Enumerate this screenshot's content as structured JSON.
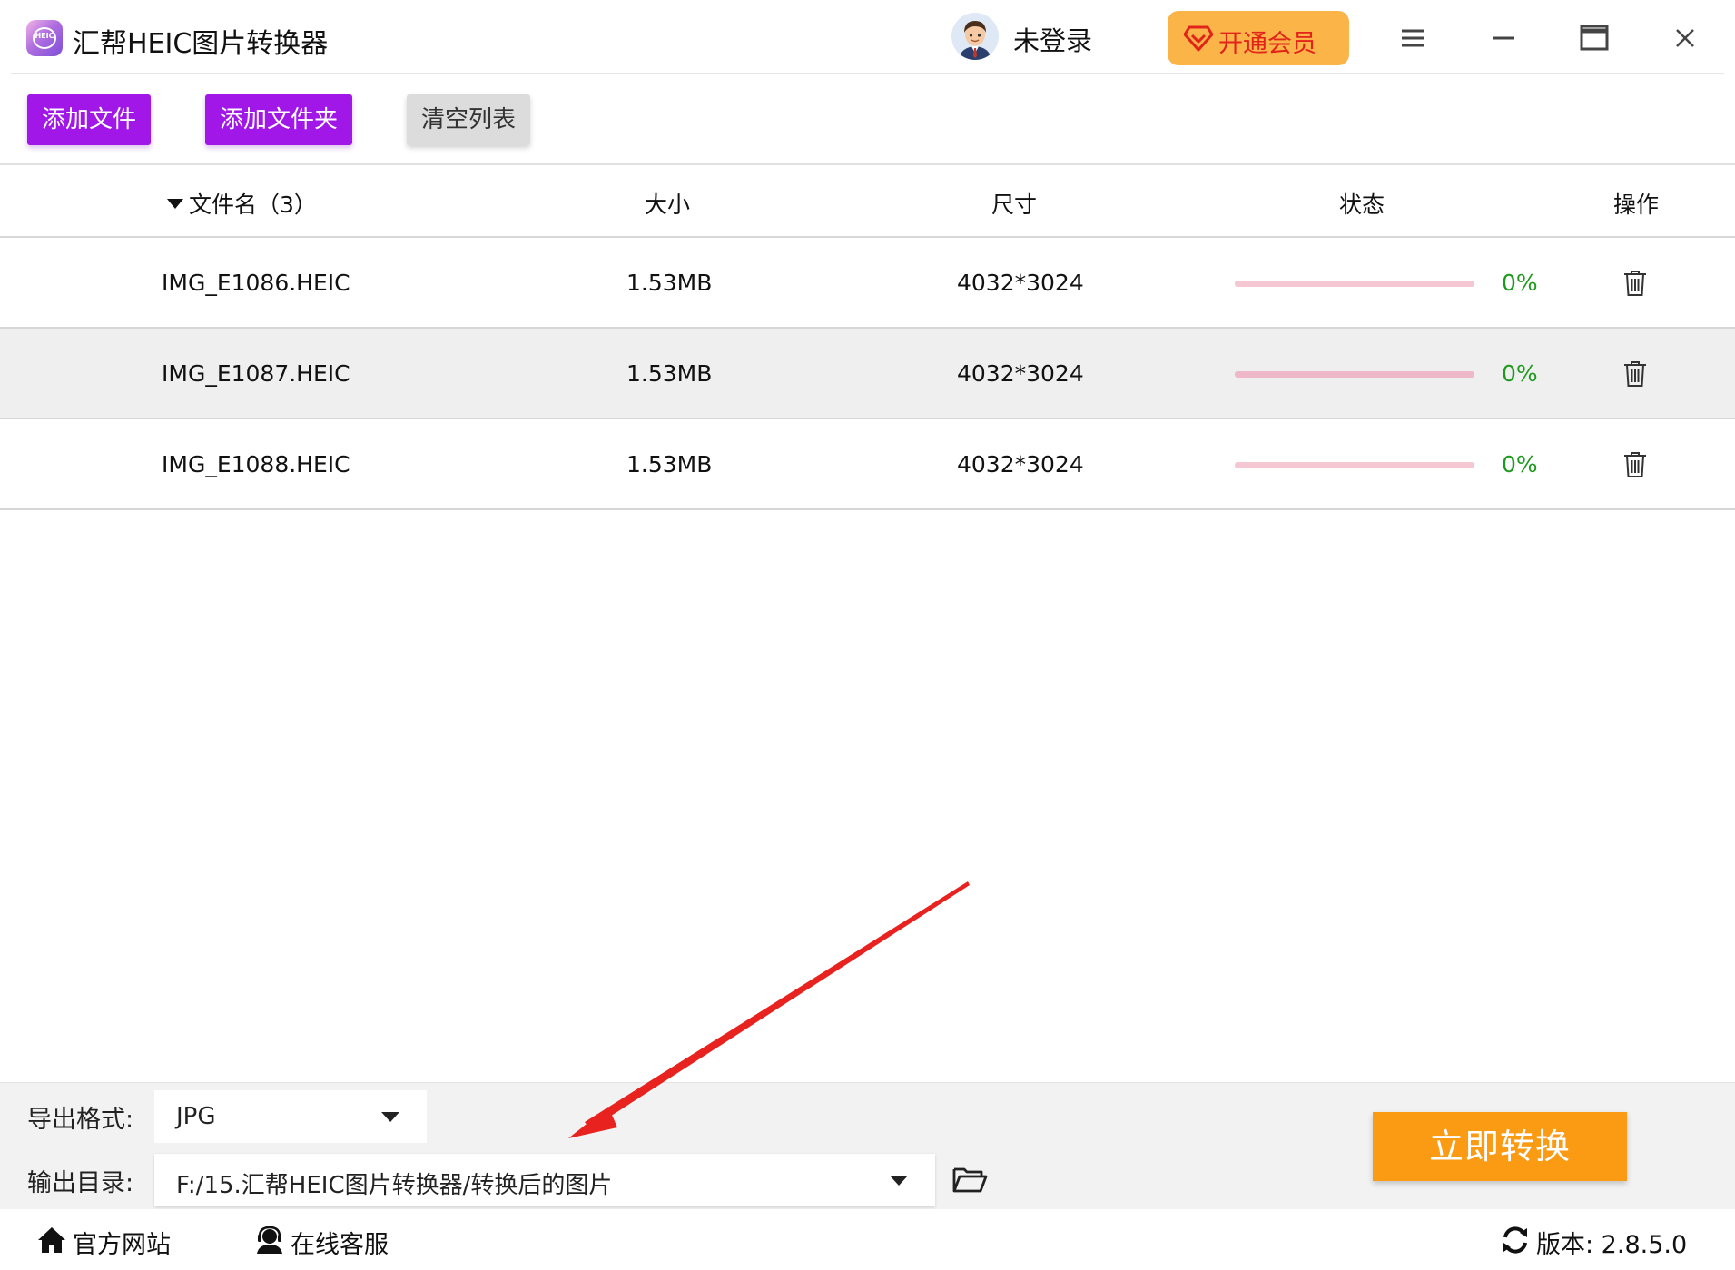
{
  "app": {
    "title": "汇帮HEIC图片转换器",
    "logo_text": "HEIC"
  },
  "header": {
    "user_label": "未登录",
    "vip_label": "开通会员"
  },
  "toolbar": {
    "add_file": "添加文件",
    "add_folder": "添加文件夹",
    "clear_list": "清空列表"
  },
  "table": {
    "columns": {
      "name": "文件名（3）",
      "size": "大小",
      "dimensions": "尺寸",
      "status": "状态",
      "operation": "操作"
    },
    "rows": [
      {
        "name": "IMG_E1086.HEIC",
        "size": "1.53MB",
        "dimensions": "4032*3024",
        "progress": 0,
        "percent": "0%"
      },
      {
        "name": "IMG_E1087.HEIC",
        "size": "1.53MB",
        "dimensions": "4032*3024",
        "progress": 0,
        "percent": "0%"
      },
      {
        "name": "IMG_E1088.HEIC",
        "size": "1.53MB",
        "dimensions": "4032*3024",
        "progress": 0,
        "percent": "0%"
      }
    ]
  },
  "settings": {
    "format_label": "导出格式:",
    "format_value": "JPG",
    "dir_label": "输出目录:",
    "dir_value": "F:/15.汇帮HEIC图片转换器/转换后的图片",
    "convert_label": "立即转换"
  },
  "footer": {
    "official_site": "官方网站",
    "online_service": "在线客服",
    "version": "版本:  2.8.5.0"
  },
  "colors": {
    "accent_purple": "#a017e8",
    "convert_orange": "#fb9a13",
    "vip_orange": "#fbb448",
    "vip_text_red": "#e2231a",
    "percent_green": "#1f9a1f",
    "progress_track_pink": "#f4c7d3",
    "annotation_arrow_red": "#e8231f"
  },
  "icons": {
    "header": [
      "avatar-icon",
      "vip-gem-icon",
      "menu-icon",
      "minimize-icon",
      "maximize-icon",
      "close-icon"
    ],
    "rows": "trash-icon",
    "settings": [
      "chevron-down-icon",
      "folder-open-icon"
    ],
    "footer": [
      "home-icon",
      "customer-service-icon",
      "refresh-icon"
    ]
  }
}
